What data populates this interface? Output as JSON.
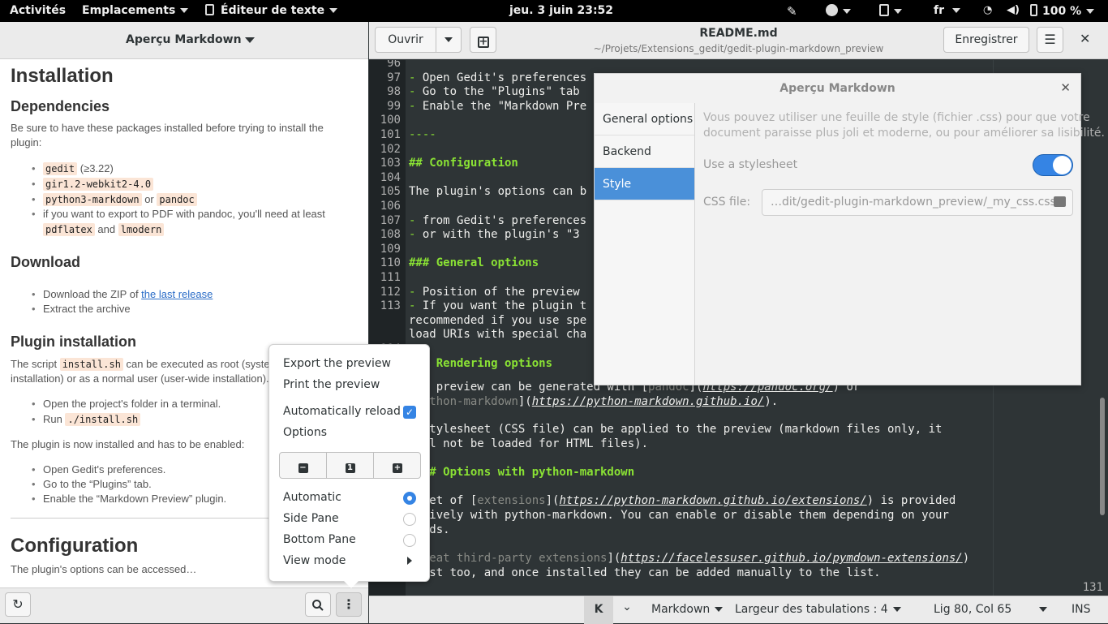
{
  "topbar": {
    "activities": "Activités",
    "places": "Emplacements",
    "app": "Éditeur de texte",
    "clock": "jeu. 3 juin  23:52",
    "lang": "fr",
    "battery": "100 %"
  },
  "left_panel": {
    "title": "Aperçu Markdown"
  },
  "preview": {
    "h_installation": "Installation",
    "h_dependencies": "Dependencies",
    "deps_intro_1": "Be sure to have these packages installed before trying to install the",
    "deps_intro_2": "plugin:",
    "dep1_code": "gedit",
    "dep1_rest": " (≥3.22)",
    "dep2_code": "gir1.2-webkit2-4.0",
    "dep3_code": "python3-markdown",
    "dep3_or": " or ",
    "dep3_code2": "pandoc",
    "dep4_line1": "if you want to export to PDF with pandoc, you'll need at least",
    "dep4_code1": "pdflatex",
    "dep4_and": " and ",
    "dep4_code2": "lmodern",
    "h_download": "Download",
    "dl1_pre": "Download the ZIP of ",
    "dl1_link": "the last release",
    "dl2": "Extract the archive",
    "h_plugin_install": "Plugin installation",
    "pi_p1_pre": "The script ",
    "pi_p1_code": "install.sh",
    "pi_p1_post": " can be executed as root (syste",
    "pi_p1_line2": "installation) or as a normal user (user-wide installation).",
    "pi_li1": "Open the project's folder in a terminal.",
    "pi_li2_pre": "Run ",
    "pi_li2_code": "./install.sh",
    "pi_p2": "The plugin is now installed and has to be enabled:",
    "en_li1": "Open Gedit's preferences.",
    "en_li2": "Go to the “Plugins” tab.",
    "en_li3": "Enable the “Markdown Preview” plugin.",
    "h_configuration": "Configuration",
    "conf_p": "The plugin's options can be accessed…"
  },
  "header": {
    "open": "Ouvrir",
    "filename": "README.md",
    "path": "~/Projets/Extensions_gedit/gedit-plugin-markdown_preview",
    "save": "Enregistrer"
  },
  "editor": {
    "lines": [
      {
        "n": "96",
        "t": ""
      },
      {
        "n": "97",
        "t": "- Open Gedit's preferences"
      },
      {
        "n": "98",
        "t": "- Go to the \"Plugins\" tab"
      },
      {
        "n": "99",
        "t": "- Enable the \"Markdown Pre"
      },
      {
        "n": "100",
        "t": ""
      },
      {
        "n": "101",
        "t": "----"
      },
      {
        "n": "102",
        "t": ""
      },
      {
        "n": "103",
        "t": "## Configuration"
      },
      {
        "n": "104",
        "t": ""
      },
      {
        "n": "105",
        "t": "The plugin's options can b"
      },
      {
        "n": "106",
        "t": ""
      },
      {
        "n": "107",
        "t": "- from Gedit's preferences"
      },
      {
        "n": "108",
        "t": "- or with the plugin's \"3"
      },
      {
        "n": "109",
        "t": ""
      },
      {
        "n": "110",
        "t": "### General options"
      },
      {
        "n": "111",
        "t": ""
      },
      {
        "n": "112",
        "t": "- Position of the preview"
      },
      {
        "n": "113",
        "t": "- If you want the plugin t"
      },
      {
        "n": "",
        "t": "recommended if you use spe"
      },
      {
        "n": "",
        "t": "load URIs with special cha"
      },
      {
        "n": "114",
        "t": ""
      },
      {
        "n": "115",
        "t": "### Rendering options"
      }
    ],
    "line_131": "131",
    "p1_a": "The preview can be generated with [",
    "p1_pandoc": "pandoc",
    "p1_b": "](",
    "p1_url": "https://pandoc.org/",
    "p1_c": ") or",
    "p1_d": "[",
    "p1_pm": "python-markdown",
    "p1_e": "](",
    "p1_url2": "https://python-markdown.github.io/",
    "p1_f": ").",
    "p2_a": "A stylesheet (CSS file) can be applied to the preview (markdown files only, it",
    "p2_b": "will not be loaded for HTML files).",
    "h_pm": "#### Options with python-markdown",
    "p3_a": "A set of [",
    "p3_ext": "extensions",
    "p3_b": "](",
    "p3_url": "https://python-markdown.github.io/extensions/",
    "p3_c": ") is provided",
    "p3_d": "natively with python-markdown. You can enable or disable them depending on your",
    "p3_e": "needs.",
    "p4_a": "[Great third-party extensions",
    "p4_b": "](",
    "p4_url": "https://facelessuser.github.io/pymdown-extensions/",
    "p4_c": ")",
    "p4_d": "exist too, and once installed they can be added manually to the list."
  },
  "dialog": {
    "title": "Aperçu Markdown",
    "tabs": [
      "General options",
      "Backend",
      "Style"
    ],
    "desc1": "Vous pouvez utiliser une feuille de style (fichier .css) pour que votre",
    "desc2": "document paraisse plus joli et moderne, ou pour améliorer sa lisibilité.",
    "use_stylesheet": "Use a stylesheet",
    "use_stylesheet_on": true,
    "css_label": "CSS file:",
    "css_value": "…dit/gedit-plugin-markdown_preview/_my_css.css"
  },
  "menu": {
    "export": "Export the preview",
    "print": "Print the preview",
    "auto_reload": "Automatically reload",
    "auto_reload_checked": true,
    "options": "Options",
    "automatic": "Automatic",
    "side_pane": "Side Pane",
    "bottom_pane": "Bottom Pane",
    "selected_position": "Automatic",
    "view_mode": "View mode"
  },
  "status": {
    "language": "Markdown",
    "tab_width": "Largeur des tabulations : 4",
    "position": "Lig 80, Col 65",
    "mode": "INS"
  },
  "colors": {
    "accent": "#3584e4",
    "sidebar_selected": "#4a90d9",
    "heading_green": "#8ae234",
    "editor_bg": "#2e3436"
  }
}
